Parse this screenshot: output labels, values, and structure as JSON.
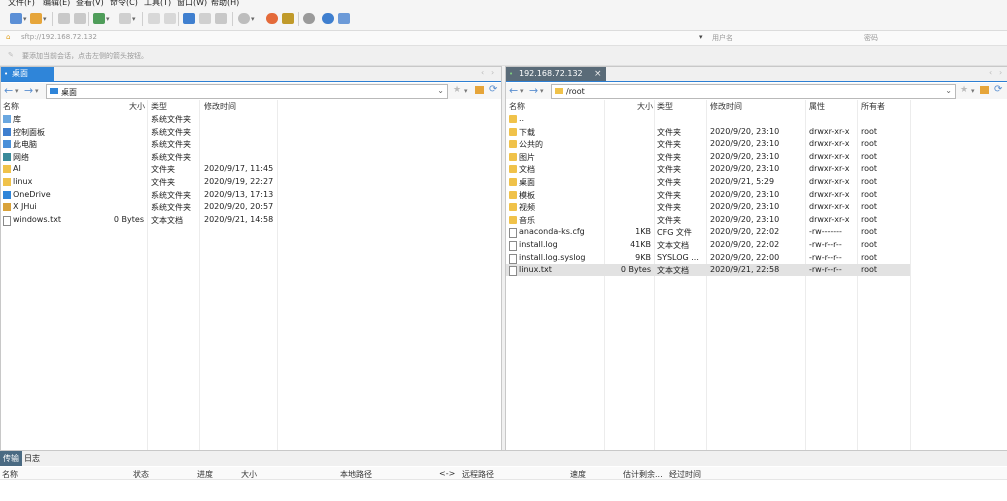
{
  "menu": [
    "文件(F)",
    "编辑(E)",
    "查看(V)",
    "命令(C)",
    "工具(T)",
    "窗口(W)",
    "帮助(H)"
  ],
  "address": {
    "host_placeholder": "sftp://192.168.72.132",
    "user_placeholder": "用户名",
    "password_placeholder": "密码"
  },
  "hint": "要添加当前会话，点击左侧的箭头按钮。",
  "left": {
    "tab": "桌面",
    "path": "桌面",
    "columns": {
      "name": "名称",
      "size": "大小",
      "type": "类型",
      "modified": "修改时间"
    },
    "rows": [
      {
        "name": "库",
        "size": "",
        "type": "系统文件夹",
        "modified": ""
      },
      {
        "name": "控制面板",
        "size": "",
        "type": "系统文件夹",
        "modified": ""
      },
      {
        "name": "此电脑",
        "size": "",
        "type": "系统文件夹",
        "modified": ""
      },
      {
        "name": "网络",
        "size": "",
        "type": "系统文件夹",
        "modified": ""
      },
      {
        "name": "AI",
        "size": "",
        "type": "文件夹",
        "modified": "2020/9/17, 11:45"
      },
      {
        "name": "linux",
        "size": "",
        "type": "文件夹",
        "modified": "2020/9/19, 22:27"
      },
      {
        "name": "OneDrive",
        "size": "",
        "type": "系统文件夹",
        "modified": "2020/9/13, 17:13"
      },
      {
        "name": "X JHui",
        "size": "",
        "type": "系统文件夹",
        "modified": "2020/9/20, 20:57"
      },
      {
        "name": "windows.txt",
        "size": "0 Bytes",
        "type": "文本文档",
        "modified": "2020/9/21, 14:58"
      }
    ]
  },
  "right": {
    "tab": "192.168.72.132",
    "path": "/root",
    "columns": {
      "name": "名称",
      "size": "大小",
      "type": "类型",
      "modified": "修改时间",
      "attr": "属性",
      "owner": "所有者"
    },
    "rows": [
      {
        "name": "..",
        "size": "",
        "type": "",
        "modified": "",
        "attr": "",
        "owner": ""
      },
      {
        "name": "下载",
        "size": "",
        "type": "文件夹",
        "modified": "2020/9/20, 23:10",
        "attr": "drwxr-xr-x",
        "owner": "root"
      },
      {
        "name": "公共的",
        "size": "",
        "type": "文件夹",
        "modified": "2020/9/20, 23:10",
        "attr": "drwxr-xr-x",
        "owner": "root"
      },
      {
        "name": "图片",
        "size": "",
        "type": "文件夹",
        "modified": "2020/9/20, 23:10",
        "attr": "drwxr-xr-x",
        "owner": "root"
      },
      {
        "name": "文档",
        "size": "",
        "type": "文件夹",
        "modified": "2020/9/20, 23:10",
        "attr": "drwxr-xr-x",
        "owner": "root"
      },
      {
        "name": "桌面",
        "size": "",
        "type": "文件夹",
        "modified": "2020/9/21, 5:29",
        "attr": "drwxr-xr-x",
        "owner": "root"
      },
      {
        "name": "模板",
        "size": "",
        "type": "文件夹",
        "modified": "2020/9/20, 23:10",
        "attr": "drwxr-xr-x",
        "owner": "root"
      },
      {
        "name": "视频",
        "size": "",
        "type": "文件夹",
        "modified": "2020/9/20, 23:10",
        "attr": "drwxr-xr-x",
        "owner": "root"
      },
      {
        "name": "音乐",
        "size": "",
        "type": "文件夹",
        "modified": "2020/9/20, 23:10",
        "attr": "drwxr-xr-x",
        "owner": "root"
      },
      {
        "name": "anaconda-ks.cfg",
        "size": "1KB",
        "type": "CFG 文件",
        "modified": "2020/9/20, 22:02",
        "attr": "-rw-------",
        "owner": "root"
      },
      {
        "name": "install.log",
        "size": "41KB",
        "type": "文本文档",
        "modified": "2020/9/20, 22:02",
        "attr": "-rw-r--r--",
        "owner": "root"
      },
      {
        "name": "install.log.syslog",
        "size": "9KB",
        "type": "SYSLOG ...",
        "modified": "2020/9/20, 22:00",
        "attr": "-rw-r--r--",
        "owner": "root"
      },
      {
        "name": "linux.txt",
        "size": "0 Bytes",
        "type": "文本文档",
        "modified": "2020/9/21, 22:58",
        "attr": "-rw-r--r--",
        "owner": "root"
      }
    ]
  },
  "transfer": {
    "tabs": [
      "传输",
      "日志"
    ],
    "columns": [
      "名称",
      "状态",
      "进度",
      "大小",
      "本地路径",
      "<->",
      "远程路径",
      "速度",
      "估计剩余...",
      "经过时间"
    ]
  },
  "colors": {
    "accent": "#2f85d9",
    "folder": "#f0c24a",
    "dark_tab": "#5a6b78"
  }
}
